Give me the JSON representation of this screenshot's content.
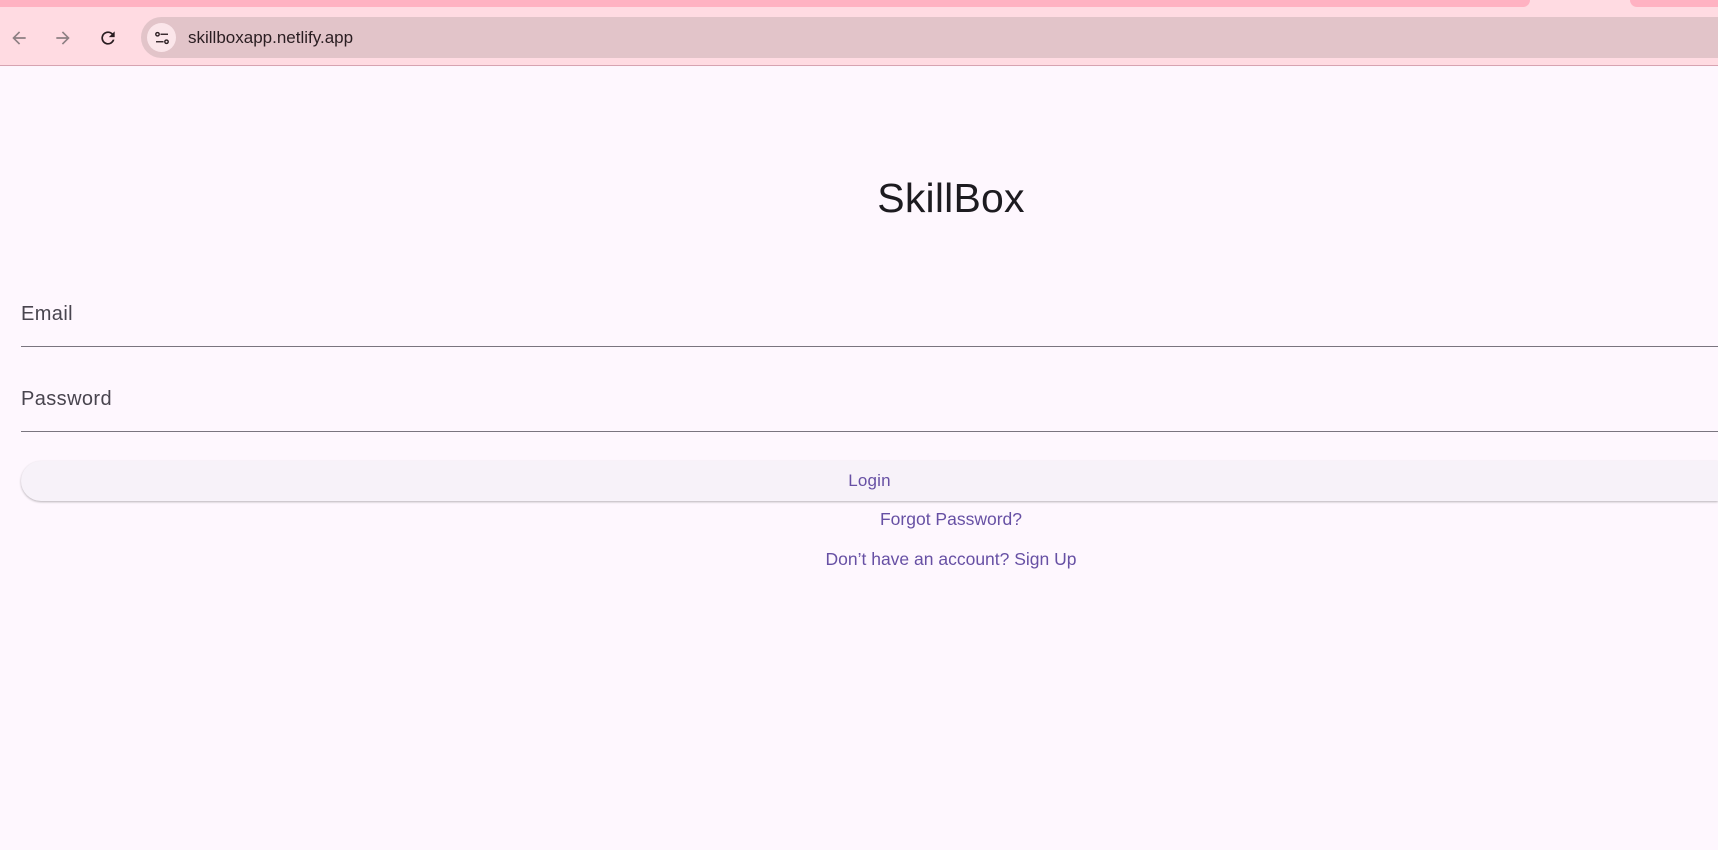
{
  "browser": {
    "url": "skillboxapp.netlify.app",
    "back_icon": "arrow-left-icon",
    "forward_icon": "arrow-right-icon",
    "reload_icon": "reload-icon",
    "site_info_icon": "tune-icon"
  },
  "app": {
    "title": "SkillBox",
    "email_label": "Email",
    "password_label": "Password",
    "login_label": "Login",
    "forgot_label": "Forgot Password?",
    "signup_label": "Don’t have an account? Sign Up"
  },
  "colors": {
    "accent": "#6750a4",
    "background": "#fef7fe",
    "browser_chrome": "#ffdbe2"
  }
}
